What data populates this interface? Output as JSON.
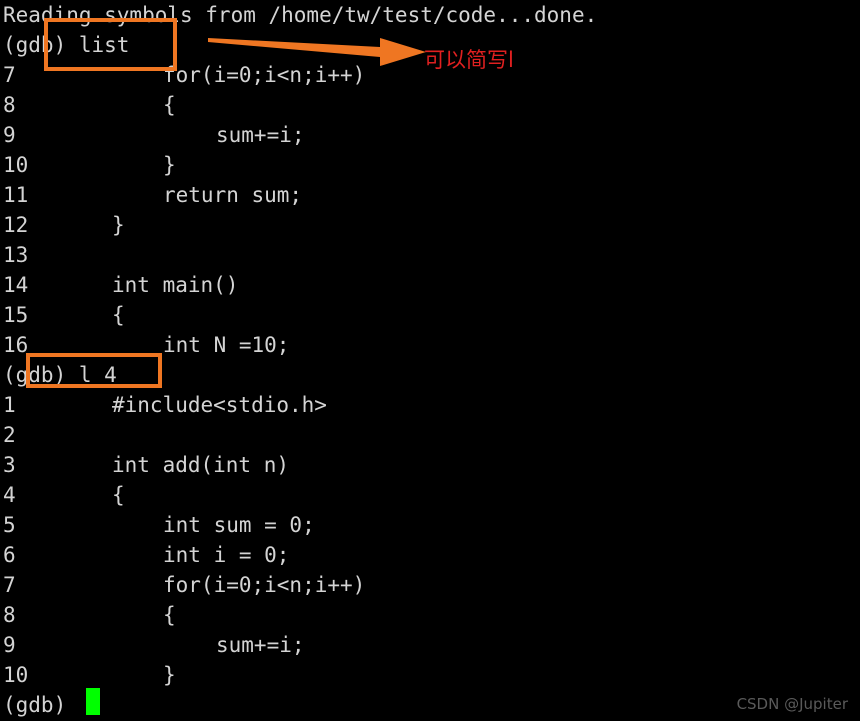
{
  "terminal": {
    "background_color": "#000000",
    "text_color": "#d4d4d4",
    "cursor_color": "#00ff00",
    "header_line": "Reading symbols from /home/tw/test/code...done.",
    "prompt_1": "(gdb) list",
    "prompt_2": "(gdb) l 4",
    "prompt_3": "(gdb) ",
    "listing_1": [
      {
        "lno": "7",
        "code": "for(i=0;i<n;i++)",
        "indent": "ind2"
      },
      {
        "lno": "8",
        "code": "{",
        "indent": "ind2"
      },
      {
        "lno": "9",
        "code": "sum+=i;",
        "indent": "ind3"
      },
      {
        "lno": "10",
        "code": "}",
        "indent": "ind2"
      },
      {
        "lno": "11",
        "code": "return sum;",
        "indent": "ind2"
      },
      {
        "lno": "12",
        "code": "}",
        "indent": "ind1"
      },
      {
        "lno": "13",
        "code": "",
        "indent": "ind1"
      },
      {
        "lno": "14",
        "code": "int main()",
        "indent": "ind1"
      },
      {
        "lno": "15",
        "code": "{",
        "indent": "ind1"
      },
      {
        "lno": "16",
        "code": "int N =10;",
        "indent": "ind2"
      }
    ],
    "listing_2": [
      {
        "lno": "1",
        "code": "#include<stdio.h>",
        "indent": "ind1"
      },
      {
        "lno": "2",
        "code": "",
        "indent": "ind1"
      },
      {
        "lno": "3",
        "code": "int add(int n)",
        "indent": "ind1"
      },
      {
        "lno": "4",
        "code": "{",
        "indent": "ind1"
      },
      {
        "lno": "5",
        "code": "int sum = 0;",
        "indent": "ind2"
      },
      {
        "lno": "6",
        "code": "int i = 0;",
        "indent": "ind2"
      },
      {
        "lno": "7",
        "code": "for(i=0;i<n;i++)",
        "indent": "ind2"
      },
      {
        "lno": "8",
        "code": "{",
        "indent": "ind2"
      },
      {
        "lno": "9",
        "code": "sum+=i;",
        "indent": "ind3"
      },
      {
        "lno": "10",
        "code": "}",
        "indent": "ind2"
      }
    ]
  },
  "annotations": {
    "box_color": "#ef7622",
    "arrow_color": "#ef7622",
    "note_color": "#e02020",
    "note_text": "可以简写l",
    "box_list_target": "(gdb) list",
    "box_l4_target": "(gdb) l 4"
  },
  "watermark": {
    "text": "CSDN @Jupiter"
  }
}
